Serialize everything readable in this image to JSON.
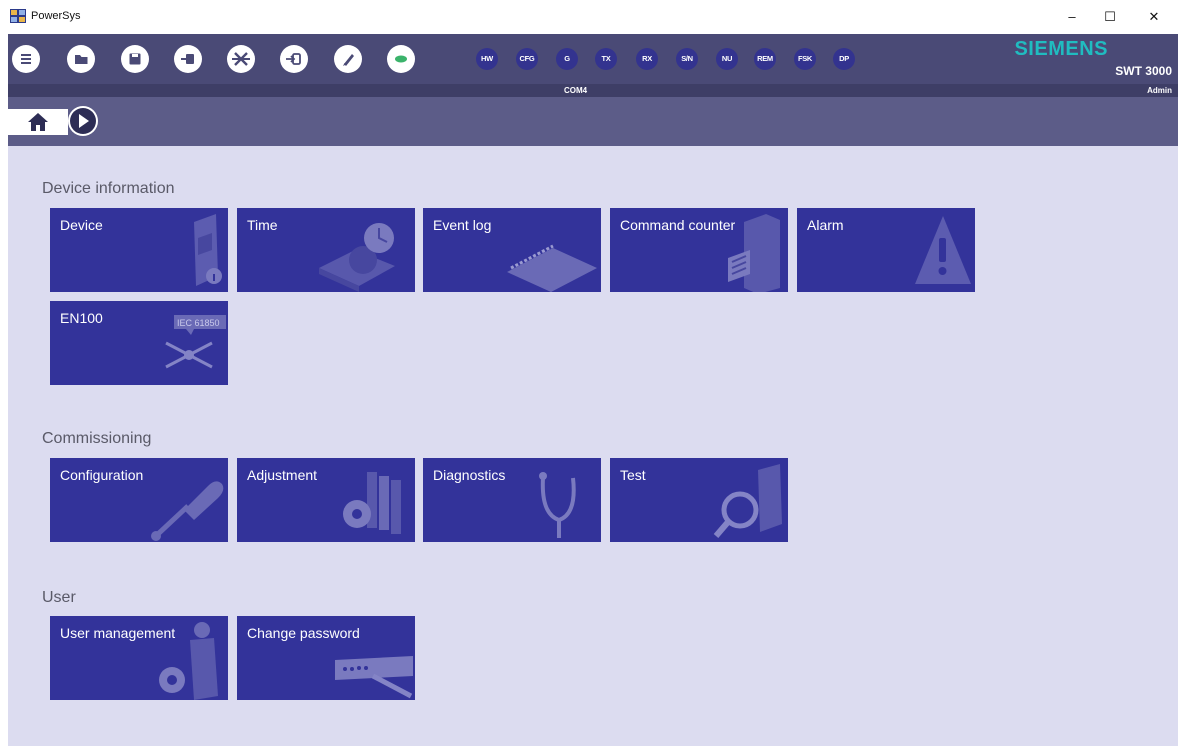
{
  "window": {
    "title": "PowerSys",
    "minimize_glyph": "–",
    "maximize_glyph": "☐",
    "close_glyph": "✕"
  },
  "toolbar": {
    "buttons": [
      {
        "name": "menu-icon"
      },
      {
        "name": "folder-open-icon"
      },
      {
        "name": "save-icon"
      },
      {
        "name": "device-connect-icon"
      },
      {
        "name": "disconnect-icon"
      },
      {
        "name": "login-icon"
      },
      {
        "name": "edit-icon"
      },
      {
        "name": "status-green-icon"
      }
    ],
    "status_pills": [
      "HW",
      "CFG",
      "G",
      "TX",
      "RX",
      "S/N",
      "NU",
      "REM",
      "FSK",
      "DP"
    ]
  },
  "brand": {
    "name": "SIEMENS",
    "product": "SWT 3000"
  },
  "status": {
    "port": "COM4",
    "role": "Admin"
  },
  "sections": [
    {
      "title": "Device information",
      "tiles": [
        {
          "label": "Device",
          "art": "device-info-icon"
        },
        {
          "label": "Time",
          "art": "clock-icon"
        },
        {
          "label": "Event log",
          "art": "notebook-icon"
        },
        {
          "label": "Command counter",
          "art": "file-cabinet-icon"
        },
        {
          "label": "Alarm",
          "art": "warning-icon"
        },
        {
          "label": "EN100",
          "art": "iec-61850-icon",
          "badge": "IEC 61850"
        }
      ]
    },
    {
      "title": "Commissioning",
      "tiles": [
        {
          "label": "Configuration",
          "art": "screwdriver-icon"
        },
        {
          "label": "Adjustment",
          "art": "gear-books-icon"
        },
        {
          "label": "Diagnostics",
          "art": "stethoscope-icon"
        },
        {
          "label": "Test",
          "art": "magnifier-icon"
        }
      ]
    },
    {
      "title": "User",
      "tiles": [
        {
          "label": "User management",
          "art": "user-gear-icon"
        },
        {
          "label": "Change password",
          "art": "password-field-icon"
        }
      ]
    }
  ],
  "colors": {
    "header": "#4a4a76",
    "nav": "#5c5c88",
    "content_bg": "#dcdcf0",
    "tile": "#33339a",
    "brand": "#20bcc0"
  }
}
